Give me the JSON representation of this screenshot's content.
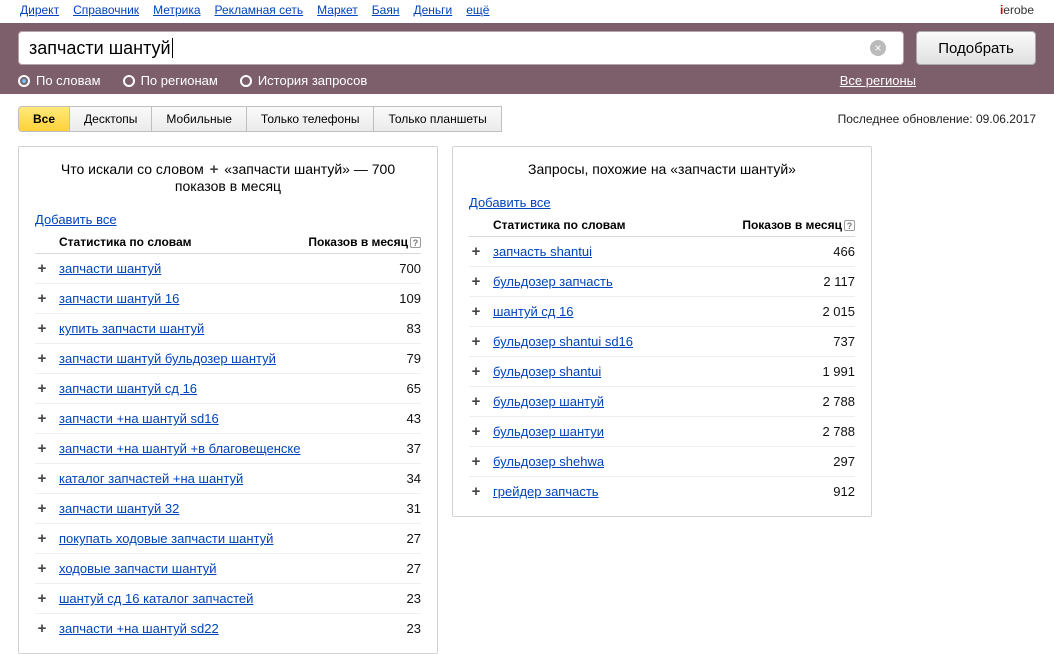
{
  "topnav": [
    "Директ",
    "Справочник",
    "Метрика",
    "Рекламная сеть",
    "Маркет",
    "Баян",
    "Деньги",
    "ещё"
  ],
  "brandRight": "ierobe",
  "search": {
    "value": "запчасти шантуй",
    "button": "Подобрать"
  },
  "filters": {
    "items": [
      {
        "label": "По словам",
        "checked": true
      },
      {
        "label": "По регионам",
        "checked": false
      },
      {
        "label": "История запросов",
        "checked": false
      }
    ],
    "allRegions": "Все регионы"
  },
  "tabs": [
    "Все",
    "Десктопы",
    "Мобильные",
    "Только телефоны",
    "Только планшеты"
  ],
  "activeTabIndex": 0,
  "lastUpdate": "Последнее обновление: 09.06.2017",
  "left": {
    "titlePrefix": "Что искали со словом",
    "query": "«запчасти шантуй»",
    "countText": "— 700 показов в месяц",
    "addAll": "Добавить все",
    "colStat": "Статистика по словам",
    "colImp": "Показов в месяц",
    "rows": [
      {
        "q": "запчасти шантуй",
        "v": "700"
      },
      {
        "q": "запчасти шантуй 16",
        "v": "109"
      },
      {
        "q": "купить запчасти шантуй",
        "v": "83"
      },
      {
        "q": "запчасти шантуй бульдозер шантуй",
        "v": "79"
      },
      {
        "q": "запчасти шантуй сд 16",
        "v": "65"
      },
      {
        "q": "запчасти +на шантуй sd16",
        "v": "43"
      },
      {
        "q": "запчасти +на шантуй +в благовещенске",
        "v": "37"
      },
      {
        "q": "каталог запчастей +на шантуй",
        "v": "34"
      },
      {
        "q": "запчасти шантуй 32",
        "v": "31"
      },
      {
        "q": "покупать ходовые запчасти шантуй",
        "v": "27"
      },
      {
        "q": "ходовые запчасти шантуй",
        "v": "27"
      },
      {
        "q": "шантуй сд 16 каталог запчастей",
        "v": "23"
      },
      {
        "q": "запчасти +на шантуй sd22",
        "v": "23"
      }
    ]
  },
  "right": {
    "title": "Запросы, похожие на «запчасти шантуй»",
    "addAll": "Добавить все",
    "colStat": "Статистика по словам",
    "colImp": "Показов в месяц",
    "rows": [
      {
        "q": "запчасть shantui",
        "v": "466"
      },
      {
        "q": "бульдозер запчасть",
        "v": "2 117"
      },
      {
        "q": "шантуй сд 16",
        "v": "2 015"
      },
      {
        "q": "бульдозер shantui sd16",
        "v": "737"
      },
      {
        "q": "бульдозер shantui",
        "v": "1 991"
      },
      {
        "q": "бульдозер шантуй",
        "v": "2 788"
      },
      {
        "q": "бульдозер шантуи",
        "v": "2 788"
      },
      {
        "q": "бульдозер shehwa",
        "v": "297"
      },
      {
        "q": "грейдер запчасть",
        "v": "912"
      }
    ]
  }
}
